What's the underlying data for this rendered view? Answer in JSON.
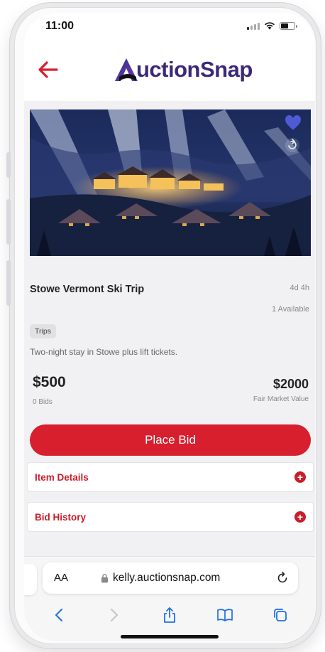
{
  "status": {
    "time": "11:00"
  },
  "app": {
    "brand": "AuctionSnap",
    "logo_letter": "A",
    "logo_rest": "uctionSnap",
    "accent": "#d71f2d",
    "brand_color": "#3a2a78"
  },
  "item": {
    "title": "Stowe Vermont Ski Trip",
    "time_left": "4d 4h",
    "availability": "1 Available",
    "tag": "Trips",
    "description": "Two-night stay in Stowe plus lift tickets.",
    "current_bid": "$500",
    "bid_count": "0 Bids",
    "fair_market_value": "$2000",
    "fmv_label": "Fair Market Value",
    "favorited": true
  },
  "actions": {
    "place_bid": "Place Bid"
  },
  "accordions": [
    {
      "label": "Item Details",
      "icon": "plus-circle-icon"
    },
    {
      "label": "Bid History",
      "icon": "plus-circle-icon"
    }
  ],
  "browser": {
    "aa_label": "AA",
    "url": "kelly.auctionsnap.com",
    "icons": [
      "back-icon",
      "forward-icon",
      "share-icon",
      "bookmarks-icon",
      "tabs-icon"
    ]
  }
}
